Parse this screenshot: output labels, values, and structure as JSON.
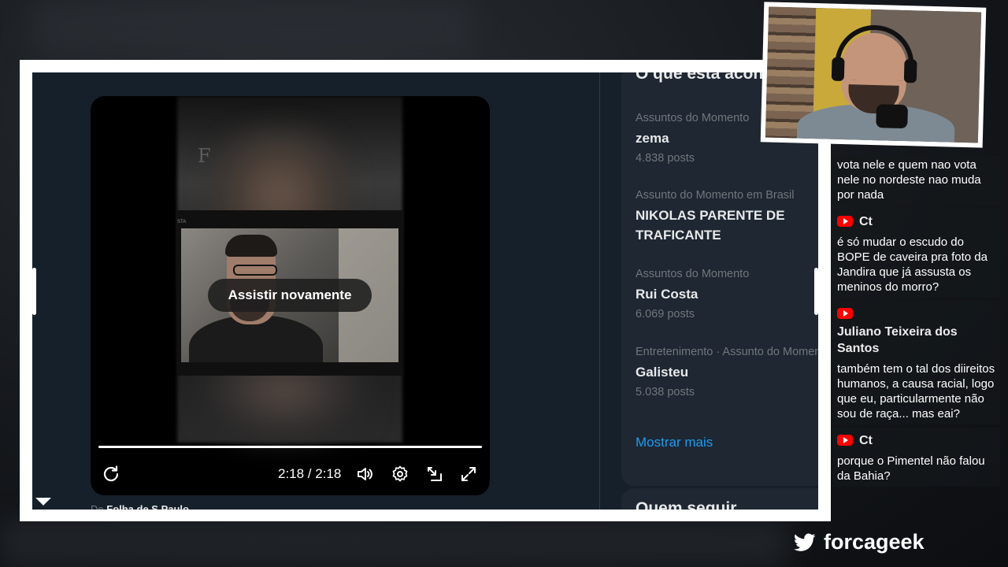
{
  "video": {
    "watermark": "F",
    "band_label": "STA",
    "replay_label": "Assistir novamente",
    "time": "2:18 / 2:18",
    "progress": 1.0,
    "byline_prefix": "De",
    "byline_source": "Folha de S.Paulo"
  },
  "trends": {
    "heading": "O que está acontecendo",
    "items": [
      {
        "category": "Assuntos do Momento",
        "name": "zema",
        "count": "4.838 posts"
      },
      {
        "category": "Assunto do Momento em Brasil",
        "name": "NIKOLAS PARENTE DE TRAFICANTE",
        "count": ""
      },
      {
        "category": "Assuntos do Momento",
        "name": "Rui Costa",
        "count": "6.069 posts"
      },
      {
        "category": "Entretenimento · Assunto do Momento",
        "name": "Galisteu",
        "count": "5.038 posts"
      }
    ],
    "show_more": "Mostrar mais",
    "who_to_follow": "Quem seguir"
  },
  "chat": {
    "messages": [
      {
        "author": "",
        "text": "vota nele e quem nao vota nele no nordeste nao muda por nada"
      },
      {
        "author": "Ct",
        "text": "é só mudar o escudo do BOPE de caveira pra foto da Jandira que já assusta os meninos do morro?"
      },
      {
        "author": "Juliano Teixeira dos Santos",
        "text": "também tem o tal dos diireitos humanos, a causa racial, logo que eu, particularmente não sou de raça... mas eai?"
      },
      {
        "author": "Ct",
        "text": "porque o Pimentel não falou da Bahia?"
      }
    ]
  },
  "brand": {
    "name": "forcageek",
    "icon": "twitter-bird-icon"
  },
  "colors": {
    "accent": "#1d9bf0",
    "panel": "#1e2732",
    "background": "#15202b",
    "youtube": "#ff0000"
  }
}
